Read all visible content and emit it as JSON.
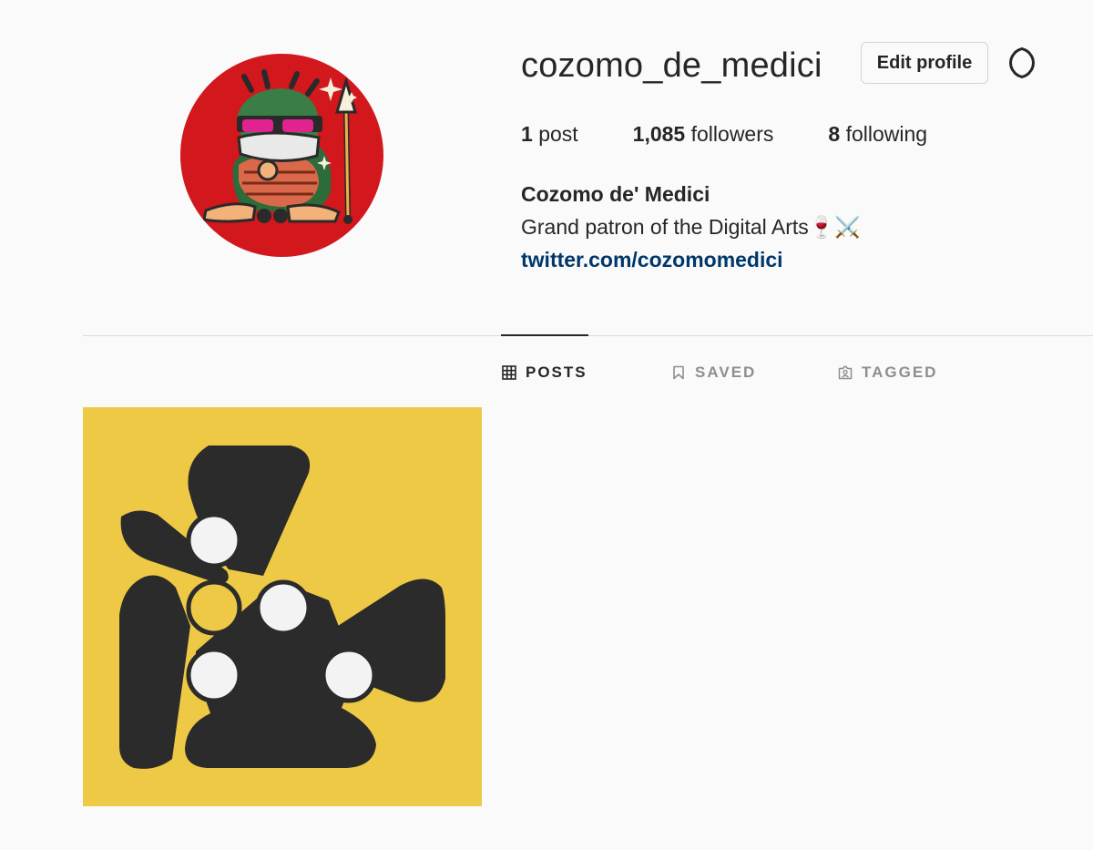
{
  "profile": {
    "username": "cozomo_de_medici",
    "edit_label": "Edit profile",
    "full_name": "Cozomo de' Medici",
    "bio": "Grand patron of the Digital Arts🍷⚔️",
    "link": "twitter.com/cozomomedici",
    "avatar_bg": "#d2171d"
  },
  "stats": {
    "posts_count": "1",
    "posts_label": "post",
    "followers_count": "1,085",
    "followers_label": "followers",
    "following_count": "8",
    "following_label": "following"
  },
  "tabs": [
    {
      "label": "POSTS",
      "icon": "grid-icon",
      "active": true
    },
    {
      "label": "SAVED",
      "icon": "bookmark-icon",
      "active": false
    },
    {
      "label": "TAGGED",
      "icon": "tagged-icon",
      "active": false
    }
  ],
  "colors": {
    "link": "#00376b",
    "post_background": "#eec946",
    "post_shape": "#2b2b2b"
  }
}
